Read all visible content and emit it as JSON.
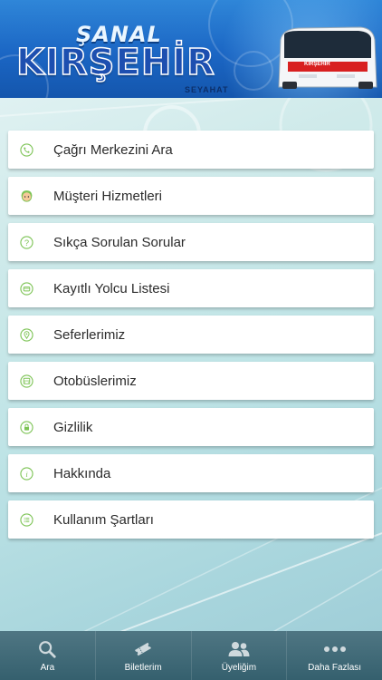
{
  "header": {
    "logo_top": "ŞANAL",
    "logo_main": "KIRŞEHİR",
    "logo_sub": "SEYAHAT",
    "bus_label": "KIRŞEHİR"
  },
  "menu": {
    "items": [
      {
        "label": "Çağrı Merkezini Ara",
        "icon": "phone-icon"
      },
      {
        "label": "Müşteri Hizmetleri",
        "icon": "customer-service-icon"
      },
      {
        "label": "Sıkça Sorulan Sorular",
        "icon": "question-icon"
      },
      {
        "label": "Kayıtlı Yolcu Listesi",
        "icon": "card-icon"
      },
      {
        "label": "Seferlerimiz",
        "icon": "location-pin-icon"
      },
      {
        "label": "Otobüslerimiz",
        "icon": "bus-icon"
      },
      {
        "label": "Gizlilik",
        "icon": "lock-icon"
      },
      {
        "label": "Hakkında",
        "icon": "info-icon"
      },
      {
        "label": "Kullanım Şartları",
        "icon": "list-icon"
      }
    ]
  },
  "tabbar": {
    "tabs": [
      {
        "label": "Ara",
        "icon": "search-icon"
      },
      {
        "label": "Biletlerim",
        "icon": "ticket-icon"
      },
      {
        "label": "Üyeliğim",
        "icon": "users-icon"
      },
      {
        "label": "Daha Fazlası",
        "icon": "more-icon"
      }
    ]
  },
  "colors": {
    "header_blue": "#1b66c4",
    "icon_green": "#7cc354",
    "tabbar": "#3f6a77"
  }
}
